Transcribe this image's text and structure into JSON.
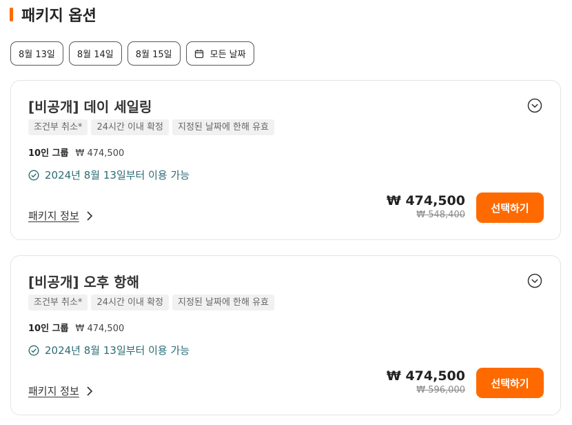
{
  "header": {
    "title": "패키지 옵션"
  },
  "dates": [
    {
      "label": "8월 13일"
    },
    {
      "label": "8월 14일"
    },
    {
      "label": "8월 15일"
    },
    {
      "label": "모든 날짜",
      "icon": "calendar-icon"
    }
  ],
  "packages": [
    {
      "title": "[비공개] 데이 세일링",
      "tags": [
        "조건부 취소*",
        "24시간 이내 확정",
        "지정된 날짜에 한해 유효"
      ],
      "group_label": "10인 그룹",
      "group_price": "₩ 474,500",
      "availability": "2024년 8월 13일부터 이용 가능",
      "info_label": "패키지 정보",
      "price": "₩ 474,500",
      "original_price": "₩ 548,400",
      "select_label": "선택하기"
    },
    {
      "title": "[비공개] 오후 항해",
      "tags": [
        "조건부 취소*",
        "24시간 이내 확정",
        "지정된 날짜에 한해 유효"
      ],
      "group_label": "10인 그룹",
      "group_price": "₩ 474,500",
      "availability": "2024년 8월 13일부터 이용 가능",
      "info_label": "패키지 정보",
      "price": "₩ 474,500",
      "original_price": "₩ 596,000",
      "select_label": "선택하기"
    }
  ],
  "colors": {
    "accent": "#ff6a00",
    "availability_text": "#2b6b74"
  }
}
